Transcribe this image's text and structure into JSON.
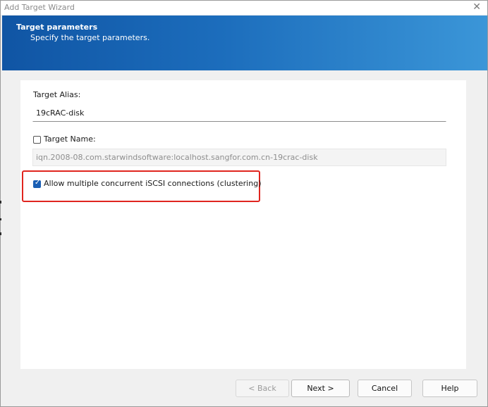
{
  "window": {
    "title": "Add Target Wizard",
    "close_glyph": "✕"
  },
  "banner": {
    "title": "Target parameters",
    "subtitle": "Specify the target parameters."
  },
  "form": {
    "alias_label": "Target Alias:",
    "alias_value": "19cRAC-disk",
    "target_name_label": "Target Name:",
    "target_name_checked": false,
    "target_name_value": "iqn.2008-08.com.starwindsoftware:localhost.sangfor.com.cn-19crac-disk",
    "clustering_label": "Allow multiple concurrent iSCSI connections (clustering)",
    "clustering_checked": true,
    "checkmark_glyph": "✓"
  },
  "buttons": {
    "back": "< Back",
    "next": "Next >",
    "cancel": "Cancel",
    "help": "Help"
  },
  "colors": {
    "banner_start": "#1055a4",
    "banner_end": "#3b96d8",
    "highlight": "#e0251f",
    "checkbox_checked": "#1a5fb4"
  },
  "icons": {
    "close": "close-icon",
    "checkmark": "checkmark-icon"
  }
}
